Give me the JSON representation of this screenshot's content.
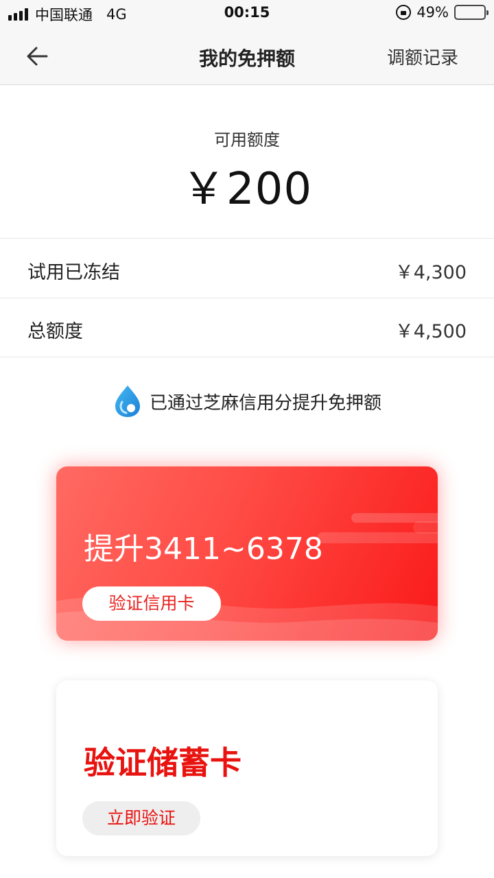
{
  "status_bar": {
    "carrier": "中国联通",
    "network": "4G",
    "time": "00:15",
    "battery_text": "49%",
    "battery_level": 0.49,
    "battery_color": "#f5c400"
  },
  "nav": {
    "back_icon": "arrow-left-icon",
    "title": "我的免押额",
    "right_link": "调额记录"
  },
  "summary": {
    "available_label": "可用额度",
    "available_amount": "￥200"
  },
  "rows": [
    {
      "label": "试用已冻结",
      "value": "￥4,300"
    },
    {
      "label": "总额度",
      "value": "￥4,500"
    }
  ],
  "zhima": {
    "icon": "zhima-drop-icon",
    "text": "已通过芝麻信用分提升免押额"
  },
  "credit_card_offer": {
    "headline": "提升3411~6378",
    "button": "验证信用卡"
  },
  "debit_card_offer": {
    "headline": "验证储蓄卡",
    "button": "立即验证"
  },
  "colors": {
    "accent_red": "#e8120f",
    "card_gradient_start": "#ff6a62",
    "card_gradient_end": "#fa1a1a"
  }
}
